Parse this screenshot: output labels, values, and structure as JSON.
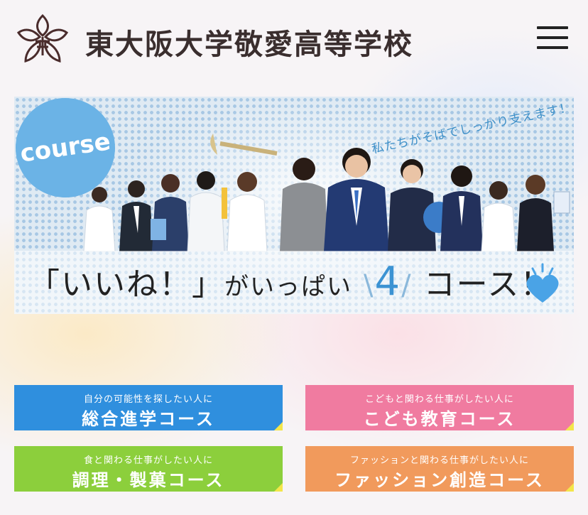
{
  "header": {
    "school_name": "東大阪大学敬愛高等学校",
    "logo_icon": "school-crest-icon",
    "menu_icon": "hamburger-menu-icon"
  },
  "banner": {
    "badge": "course",
    "subcopy": "私たちがそばでしっかり支えます！",
    "tagline": {
      "part1": "「いいね！」",
      "part2": "がいっぱい",
      "number": "4",
      "part3": "コース！"
    },
    "heart_icon": "blue-heart-icon",
    "colors": {
      "accent": "#3c93d3",
      "badge": "#6bb3e6"
    }
  },
  "courses": [
    {
      "lead": "自分の可能性を探したい人に",
      "name": "総合進学コース",
      "color": "#2f8fde"
    },
    {
      "lead": "こどもと関わる仕事がしたい人に",
      "name": "こども教育コース",
      "color": "#f07ba0"
    },
    {
      "lead": "食と関わる仕事がしたい人に",
      "name": "調理・製菓コース",
      "color": "#8ccf3c"
    },
    {
      "lead": "ファッションと関わる仕事がしたい人に",
      "name": "ファッション創造コース",
      "color": "#f19a5c"
    }
  ]
}
